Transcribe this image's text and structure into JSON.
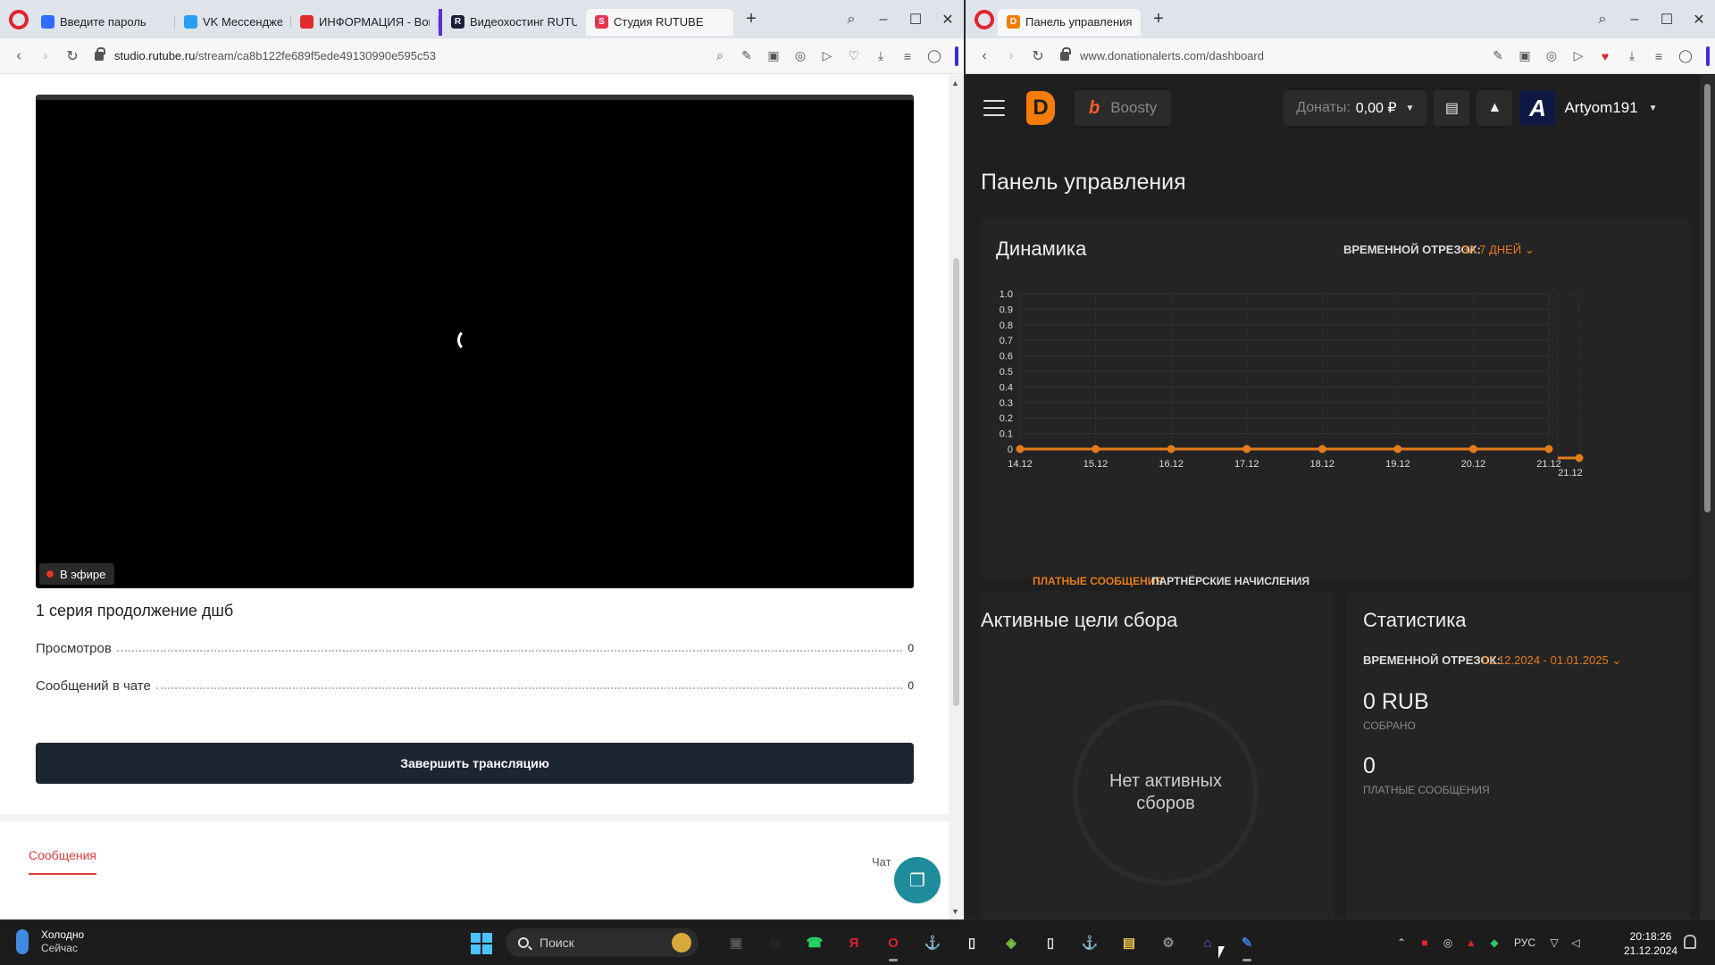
{
  "left_browser": {
    "tabs": [
      {
        "label": "Введите пароль",
        "icon": "opera-globe-icon",
        "color": "#2f6bff",
        "active": false
      },
      {
        "label": "VK Мессенджер",
        "icon": "vk-messenger-icon",
        "color": "#2a9df4",
        "active": false
      },
      {
        "label": "ИНФОРМАЦИЯ - Воин",
        "icon": "red-triangle-icon",
        "color": "#e22a2a",
        "active": false
      },
      {
        "label": "Видеохостинг RUTUBE",
        "icon": "rutube-icon",
        "color": "#1d1d3a",
        "active": false
      },
      {
        "label": "Студия RUTUBE",
        "icon": "rutube-studio-icon",
        "color": "#e6364f",
        "active": true
      }
    ],
    "url": {
      "host": "studio.rutube.ru",
      "path": "/stream/ca8b122fe689f5ede49130990e595c53"
    }
  },
  "rutube": {
    "live_badge": "В эфире",
    "title": "1 серия продолжение дшб",
    "stats": [
      {
        "label": "Просмотров",
        "value": "0"
      },
      {
        "label": "Сообщений в чате",
        "value": "0"
      }
    ],
    "end_button": "Завершить трансляцию",
    "messages_tab": "Сообщения",
    "chat_label": "Чат"
  },
  "right_browser": {
    "tabs": [
      {
        "label": "Панель управления - Па",
        "icon": "donationalerts-tab-icon",
        "color": "#f57d07",
        "active": true
      }
    ],
    "url": {
      "host": "www.donationalerts.com",
      "path": "/dashboard"
    }
  },
  "donationalerts": {
    "logo_letter": "D",
    "boosty_icon": "b",
    "boosty_label": "Boosty",
    "donations_label": "Донаты:",
    "donations_value": "0,00 ₽",
    "user_avatar_letter": "A",
    "username": "Artyom191",
    "page_title": "Панель управления",
    "dynamics": {
      "title": "Динамика",
      "period_label": "ВРЕМЕННОЙ ОТРЕЗОК:",
      "period_value": "ЗА 7 ДНЕЙ",
      "tabs": [
        "ПЛАТНЫЕ СООБЩЕНИЯ",
        "ПАРТНЁРСКИЕ НАЧИСЛЕНИЯ"
      ]
    },
    "goals": {
      "title": "Активные цели сбора",
      "empty_text": "Нет активных сборов"
    },
    "statistics": {
      "title": "Статистика",
      "period_label": "ВРЕМЕННОЙ ОТРЕЗОК:",
      "period_value": "01.12.2024 - 01.01.2025",
      "collected_value": "0 RUB",
      "collected_caption": "СОБРАНО",
      "messages_value": "0",
      "messages_caption": "ПЛАТНЫЕ СООБЩЕНИЯ"
    },
    "accent_color": "#e57b1b"
  },
  "chart_data": {
    "type": "line",
    "x": [
      "14.12",
      "15.12",
      "16.12",
      "17.12",
      "18.12",
      "19.12",
      "20.12",
      "21.12"
    ],
    "series": [
      {
        "values": [
          0,
          0,
          0,
          0,
          0,
          0,
          0,
          0
        ]
      }
    ],
    "yticks": [
      "0",
      "0.1",
      "0.2",
      "0.3",
      "0.4",
      "0.5",
      "0.6",
      "0.7",
      "0.8",
      "0.9",
      "1.0"
    ],
    "ylim": [
      0,
      1.0
    ],
    "grid": true,
    "color": "#e57b1b",
    "navigator_label": "21.12"
  },
  "taskbar": {
    "weather_title": "Холодно",
    "weather_sub": "Сейчас",
    "search_placeholder": "Поиск",
    "apps": [
      "task-view-icon",
      "app-icon",
      "whatsapp-icon",
      "yandex-browser-icon",
      "opera-icon",
      "steam-icon",
      "file-icon",
      "bluestacks-icon",
      "document-icon",
      "steam-alt-icon",
      "explorer-icon",
      "settings-icon",
      "home-app-icon",
      "pen-app-icon"
    ],
    "language": "РУС",
    "time": "20:18:26",
    "date": "21.12.2024"
  }
}
